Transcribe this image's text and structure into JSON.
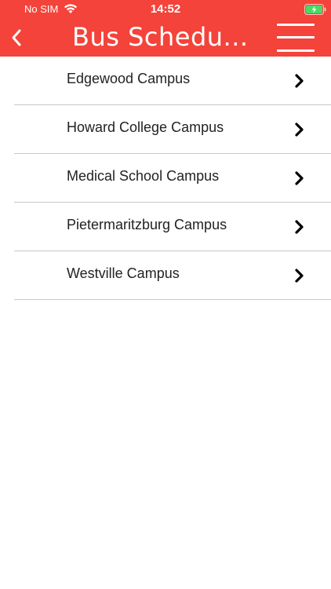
{
  "status_bar": {
    "carrier": "No SIM",
    "time": "14:52",
    "wifi_icon": "wifi-icon",
    "battery_icon": "battery-charging-icon"
  },
  "nav": {
    "title": "Bus Schedu...",
    "back_icon": "chevron-left-icon",
    "menu_icon": "hamburger-menu-icon"
  },
  "campuses": [
    {
      "label": "Edgewood Campus"
    },
    {
      "label": "Howard College Campus"
    },
    {
      "label": "Medical School Campus"
    },
    {
      "label": "Pietermaritzburg Campus"
    },
    {
      "label": "Westville Campus"
    }
  ],
  "colors": {
    "accent": "#f4433a",
    "battery_fill": "#4cd964"
  }
}
